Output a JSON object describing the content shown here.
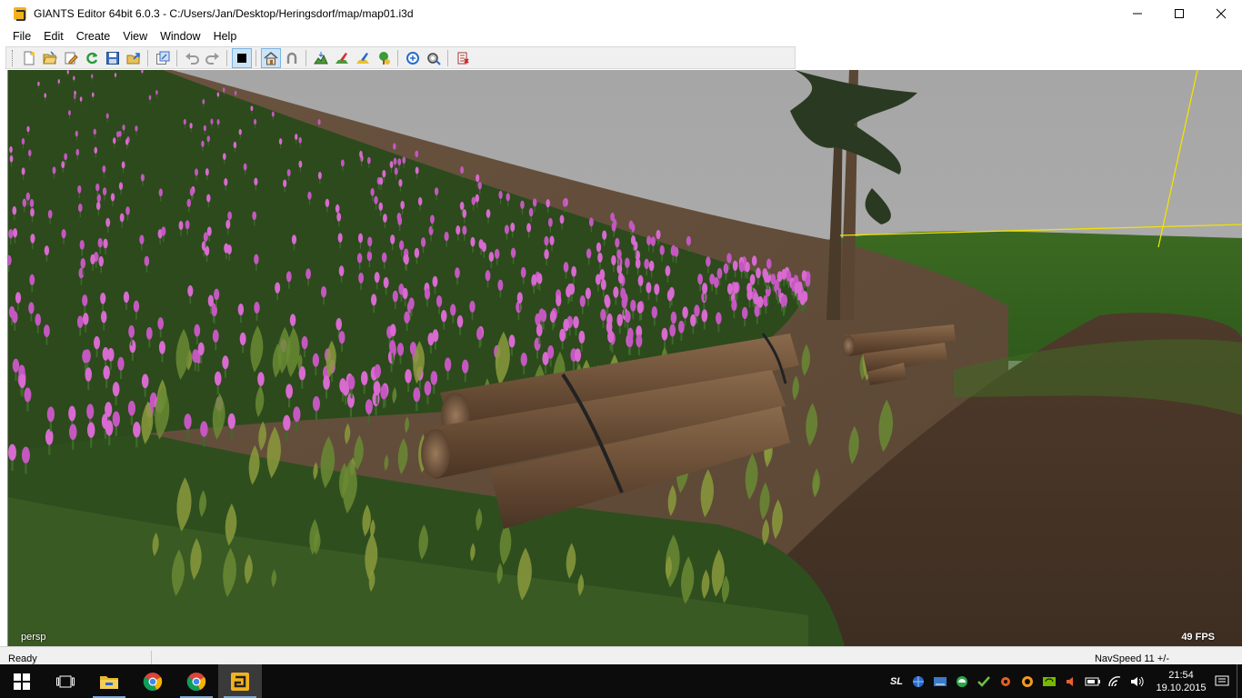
{
  "window": {
    "title": "GIANTS Editor 64bit 6.0.3 - C:/Users/Jan/Desktop/Heringsdorf/map/map01.i3d",
    "minimize": "—",
    "maximize": "☐",
    "close": "✕"
  },
  "menu": {
    "items": [
      "File",
      "Edit",
      "Create",
      "View",
      "Window",
      "Help"
    ]
  },
  "toolbar": {
    "buttons": [
      {
        "icon": "new-file-icon"
      },
      {
        "icon": "open-folder-icon"
      },
      {
        "icon": "edit-icon"
      },
      {
        "icon": "refresh-icon"
      },
      {
        "icon": "save-icon"
      },
      {
        "icon": "export-icon"
      },
      {
        "icon": "import-icon"
      },
      {
        "icon": "undo-icon"
      },
      {
        "icon": "redo-icon"
      },
      {
        "icon": "select-mode-icon",
        "active": true
      },
      {
        "icon": "home-icon",
        "active": true
      },
      {
        "icon": "magnet-icon"
      },
      {
        "icon": "terrain-sculpt-icon"
      },
      {
        "icon": "terrain-paint-icon"
      },
      {
        "icon": "foliage-paint-icon"
      },
      {
        "icon": "tree-paint-icon"
      },
      {
        "icon": "scripts-icon"
      },
      {
        "icon": "settings-icon"
      },
      {
        "icon": "delete-icon"
      }
    ]
  },
  "viewport": {
    "camera_label": "persp",
    "fps": "49 FPS"
  },
  "status": {
    "left": "Ready",
    "right": "NavSpeed 11 +/-"
  },
  "taskbar": {
    "apps": [
      "start-icon",
      "task-view-icon",
      "file-explorer-icon",
      "chrome-icon",
      "chrome-icon",
      "giants-editor-icon"
    ],
    "tray_text": "SL",
    "time": "21:54",
    "date": "19.10.2015"
  },
  "colors": {
    "accent": "#f2b21c",
    "selection_blue": "#cce4f7",
    "taskbar": "#0c0c0c"
  }
}
